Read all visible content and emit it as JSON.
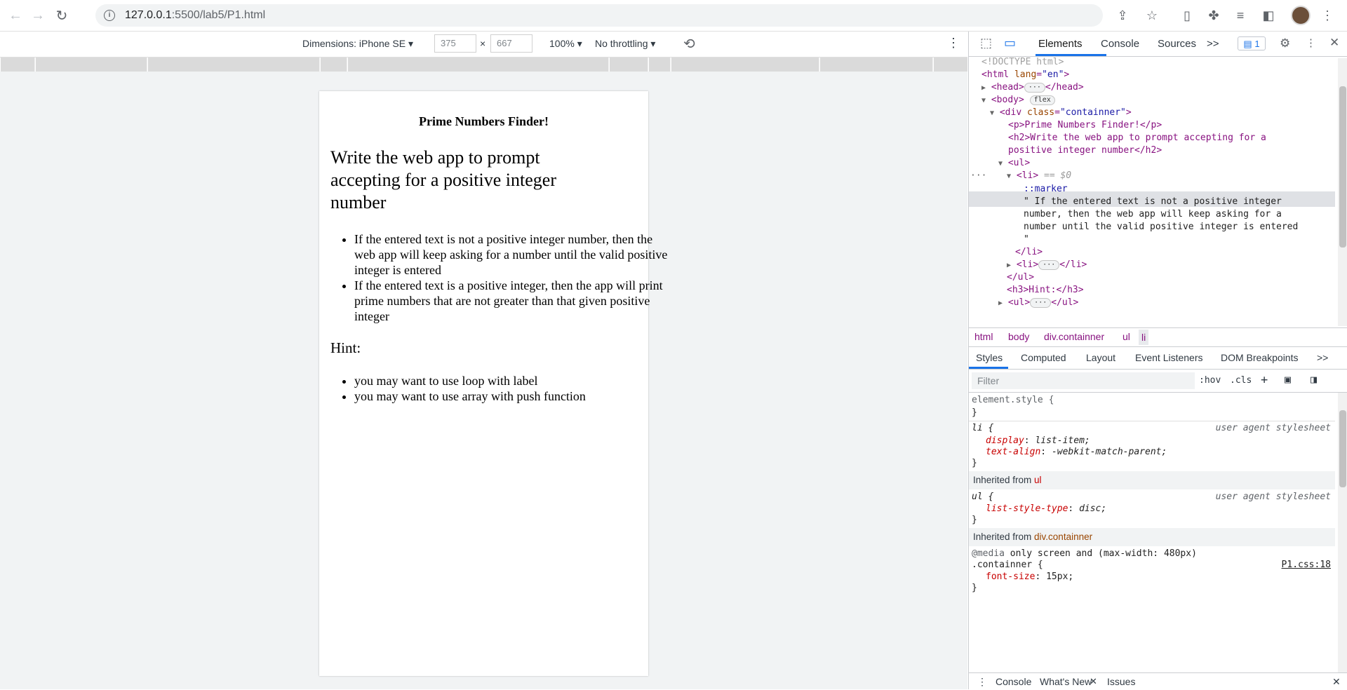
{
  "browser": {
    "url_host": "127.0.0.1",
    "url_path": ":5500/lab5/P1.html"
  },
  "device_toolbar": {
    "dimensions_label": "Dimensions: iPhone SE",
    "width": "375",
    "height": "667",
    "times": "×",
    "zoom": "100%",
    "throttling": "No throttling"
  },
  "page": {
    "title": "Prime Numbers Finder!",
    "heading": "Write the web app to prompt accepting for a positive integer number",
    "items": [
      "If the entered text is not a positive integer number, then the web app will keep asking for a number until the valid positive integer is entered",
      "If the entered text is a positive integer, then the app will print prime numbers that are not greater than that given positive integer"
    ],
    "hint_heading": "Hint:",
    "hints": [
      "you may want to use loop with label",
      "you may want to use array with push function"
    ]
  },
  "devtools": {
    "tabs": [
      "Elements",
      "Console",
      "Sources",
      ">>"
    ],
    "issue_count": "1",
    "dom": {
      "doctype": "<!DOCTYPE html>",
      "html_open": "<html ",
      "html_attr": "lang",
      "html_val": "\"en\"",
      "head": "<head>",
      "head_close": "</head>",
      "body": "<body>",
      "flex_pill": "flex",
      "div_open": "<div ",
      "div_attr": "class",
      "div_val": "\"containner\"",
      "p_line": "<p>Prime Numbers Finder!</p>",
      "h2_line1": "<h2>Write the web app to prompt accepting for a",
      "h2_line2": "positive integer number</h2>",
      "ul_open": "<ul>",
      "li_sel": "<li>",
      "li_eq": " == $0",
      "marker": "::marker",
      "text1": "\" If the entered text is not a positive integer",
      "text2": "number, then the web app will keep asking for a",
      "text3": "number until the valid positive integer is entered",
      "text4": "\"",
      "li_close": "</li>",
      "li2": "<li>",
      "li2_close": "</li>",
      "ul_close": "</ul>",
      "h3_line": "<h3>Hint:</h3>",
      "ul2": "<ul>",
      "ul2_close": "</ul>",
      "ellipsis": "···"
    },
    "breadcrumbs": [
      "html",
      "body",
      "div.containner",
      "ul",
      "li"
    ],
    "subtabs": [
      "Styles",
      "Computed",
      "Layout",
      "Event Listeners",
      "DOM Breakpoints",
      ">>"
    ],
    "filter_placeholder": "Filter",
    "hov": ":hov",
    "cls": ".cls",
    "styles": {
      "element_style": "element.style {",
      "close": "}",
      "li_sel": "li {",
      "ua": "user agent stylesheet",
      "p1": "display",
      "v1": "list-item;",
      "p2": "text-align",
      "v2": "-webkit-match-parent;",
      "inh_ul_label": "Inherited from ",
      "inh_ul_sel": "ul",
      "ul_sel": "ul {",
      "p3": "list-style-type",
      "v3": "disc;",
      "inh_div_label": "Inherited from ",
      "inh_div_sel": "div.containner",
      "media": "@media",
      "media_q": " only screen and (max-width: 480px)",
      "cont_sel": ".containner {",
      "css_link": "P1.css:18",
      "p4": "font-size",
      "v4": "15px;"
    },
    "drawer_tabs": [
      "Console",
      "What's New",
      "Issues"
    ]
  }
}
